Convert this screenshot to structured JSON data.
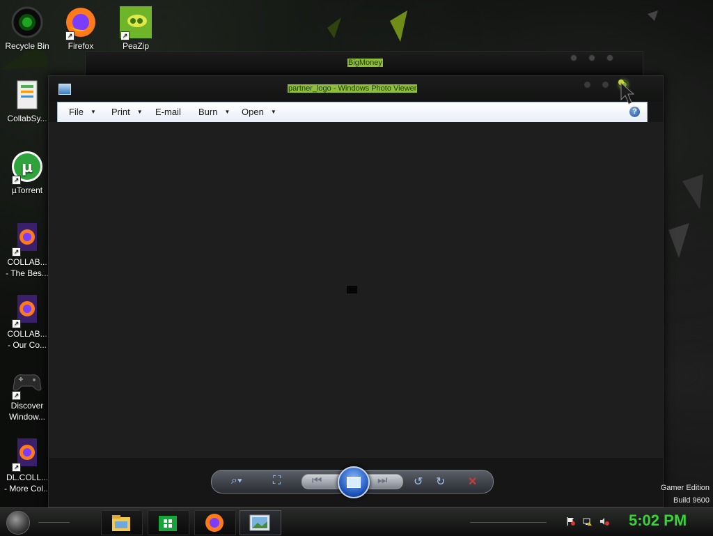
{
  "desktop": {
    "icons": [
      {
        "label_line1": "Recycle Bin",
        "label_line2": "",
        "icon": "recycle-bin-icon"
      },
      {
        "label_line1": "Firefox",
        "label_line2": "",
        "icon": "firefox-icon"
      },
      {
        "label_line1": "PeaZip",
        "label_line2": "",
        "icon": "peazip-icon"
      },
      {
        "label_line1": "CollabSy...",
        "label_line2": "",
        "icon": "document-icon"
      },
      {
        "label_line1": "µTorrent",
        "label_line2": "",
        "icon": "utorrent-icon"
      },
      {
        "label_line1": "COLLAB...",
        "label_line2": "- The Bes...",
        "icon": "firefox-doc-icon"
      },
      {
        "label_line1": "COLLAB...",
        "label_line2": "- Our Co...",
        "icon": "firefox-doc-icon"
      },
      {
        "label_line1": "Discover",
        "label_line2": "Window...",
        "icon": "gamepad-icon"
      },
      {
        "label_line1": "DL.COLL...",
        "label_line2": "- More Col...",
        "icon": "firefox-doc-icon"
      }
    ]
  },
  "back_window": {
    "title": "BigMoney"
  },
  "window": {
    "title": "partner_logo - Windows Photo Viewer",
    "menu": {
      "file": "File",
      "print": "Print",
      "email": "E-mail",
      "burn": "Burn",
      "open": "Open"
    },
    "help": "?"
  },
  "watermark": {
    "line1": "Gamer Edition",
    "line2": "Build 9600"
  },
  "taskbar": {
    "clock": "5:02 PM",
    "apps": [
      "file-explorer-icon",
      "store-icon",
      "firefox-icon",
      "photo-viewer-icon"
    ]
  },
  "colors": {
    "title_highlight": "#8fbf3a",
    "clock": "#37d437",
    "delete": "#d23a3a"
  }
}
